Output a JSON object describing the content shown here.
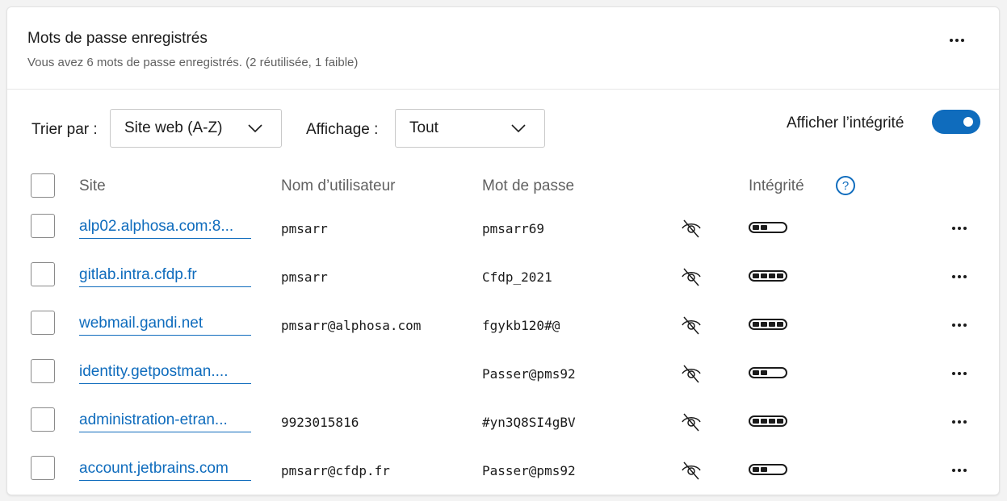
{
  "header": {
    "title": "Mots de passe enregistrés",
    "subtitle": "Vous avez 6 mots de passe enregistrés. (2 réutilisée, 1 faible)"
  },
  "filters": {
    "sort_label": "Trier par :",
    "sort_value": "Site web (A-Z)",
    "view_label": "Affichage :",
    "view_value": "Tout",
    "health_toggle_label": "Afficher l’intégrité",
    "health_toggle_on": true
  },
  "table": {
    "columns": {
      "site": "Site",
      "username": "Nom d’utilisateur",
      "password": "Mot de passe",
      "health": "Intégrité"
    },
    "help_glyph": "?",
    "rows": [
      {
        "site": "alp02.alphosa.com:8...",
        "username": "pmsarr",
        "password": "pmsarr69",
        "health_level": 2
      },
      {
        "site": "gitlab.intra.cfdp.fr",
        "username": "pmsarr",
        "password": "Cfdp_2021",
        "health_level": 4
      },
      {
        "site": "webmail.gandi.net",
        "username": "pmsarr@alphosa.com",
        "password": "fgykb120#@",
        "health_level": 4
      },
      {
        "site": "identity.getpostman....",
        "username": "",
        "password": "Passer@pms92",
        "health_level": 2
      },
      {
        "site": "administration-etran...",
        "username": "9923015816",
        "password": "#yn3Q8SI4gBV",
        "health_level": 4
      },
      {
        "site": "account.jetbrains.com",
        "username": "pmsarr@cfdp.fr",
        "password": "Passer@pms92",
        "health_level": 2
      }
    ],
    "row_icons": [
      "eye-off-icon",
      "more-horizontal-icon"
    ]
  },
  "colors": {
    "accent": "#0f6cbd",
    "text": "#1b1b1b",
    "muted": "#616161"
  }
}
